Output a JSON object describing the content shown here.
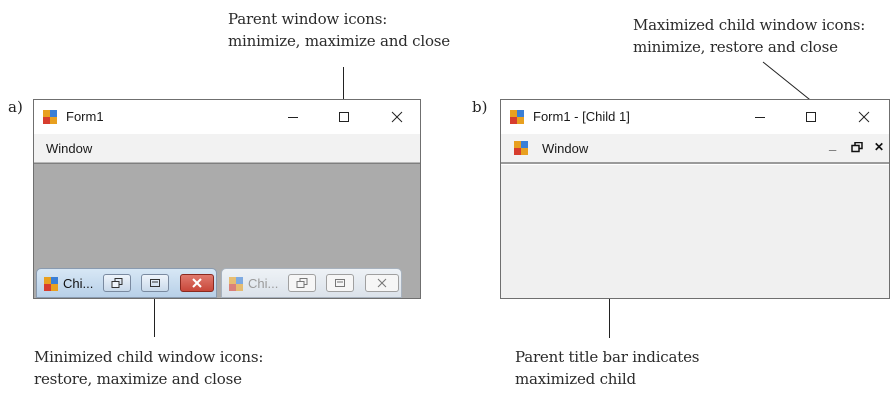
{
  "captions": {
    "parent_icons": [
      "Parent window icons:",
      "minimize, maximize and close"
    ],
    "max_child_icons": [
      "Maximized child window icons:",
      "minimize, restore and close"
    ],
    "min_child_icons": [
      "Minimized child window icons:",
      "restore, maximize and close"
    ],
    "parent_title": [
      "Parent title bar indicates",
      "maximized child"
    ]
  },
  "panels": {
    "a": "a)",
    "b": "b)"
  },
  "window_a": {
    "title": "Form1",
    "menu": "Window",
    "caption_buttons": [
      "minimize-icon",
      "maximize-icon",
      "close-icon"
    ],
    "min_children": [
      {
        "title": "Chi...",
        "active": true
      },
      {
        "title": "Chi...",
        "active": false
      }
    ]
  },
  "window_b": {
    "title": "Form1 - [Child 1]",
    "menu": "Window",
    "child_glyphs": {
      "minimize": "_",
      "restore": "🗗",
      "close": "✕"
    }
  },
  "colors": {
    "mdi_background_a": "#ababab",
    "mdi_background_b": "#f0f0f0",
    "active_min_child": "#c6dcef",
    "inactive_min_child": "#e4e9ef",
    "close_red": "#c8473a"
  }
}
